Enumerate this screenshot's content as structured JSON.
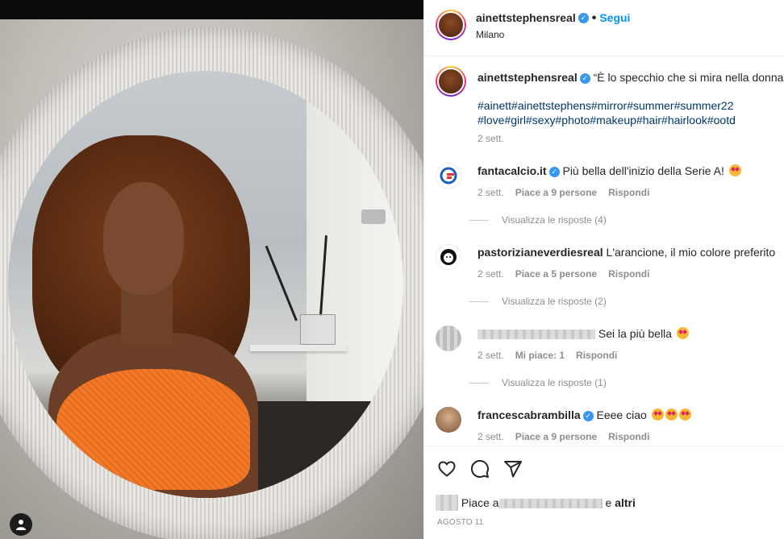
{
  "post": {
    "username": "ainettstephensreal",
    "follow_label": "Segui",
    "location": "Milano",
    "caption": "“È lo specchio che si mira nella donna”",
    "hashtags_line1": "#ainett#ainettstephens#mirror#summer#summer22",
    "hashtags_line2": "#love#girl#sexy#photo#makeup#hair#hairlook#ootd",
    "caption_time": "2 sett."
  },
  "comments": [
    {
      "username": "fantacalcio.it",
      "verified": true,
      "text": "Più bella dell'inizio della Serie A!",
      "time": "2 sett.",
      "likes": "Piace a 9 persone",
      "reply_label": "Rispondi",
      "view_replies": "Visualizza le risposte (4)"
    },
    {
      "username": "pastorizianeverdiesreal",
      "verified": false,
      "text": "L'arancione, il mio colore preferito",
      "time": "2 sett.",
      "likes": "Piace a 5 persone",
      "reply_label": "Rispondi",
      "view_replies": "Visualizza le risposte (2)"
    },
    {
      "username": "",
      "verified": false,
      "text": "Sei la più bella",
      "time": "2 sett.",
      "likes": "Mi piace: 1",
      "reply_label": "Rispondi",
      "view_replies": "Visualizza le risposte (1)"
    },
    {
      "username": "francescabrambilla",
      "verified": true,
      "text": "Eeee ciao",
      "time": "2 sett.",
      "likes": "Piace a 9 persone",
      "reply_label": "Rispondi"
    }
  ],
  "footer": {
    "likes_prefix": "Piace a",
    "likes_suffix": "e",
    "likes_others": "altri",
    "date": "AGOSTO 11"
  },
  "icons": {
    "like": "heart-icon",
    "comment": "comment-icon",
    "share": "share-icon",
    "verified": "verified-badge-icon",
    "profile": "user-icon"
  },
  "colors": {
    "follow": "#0095f6",
    "verified": "#3897f0",
    "hashtag": "#00376b",
    "muted": "#8e8e8e"
  }
}
